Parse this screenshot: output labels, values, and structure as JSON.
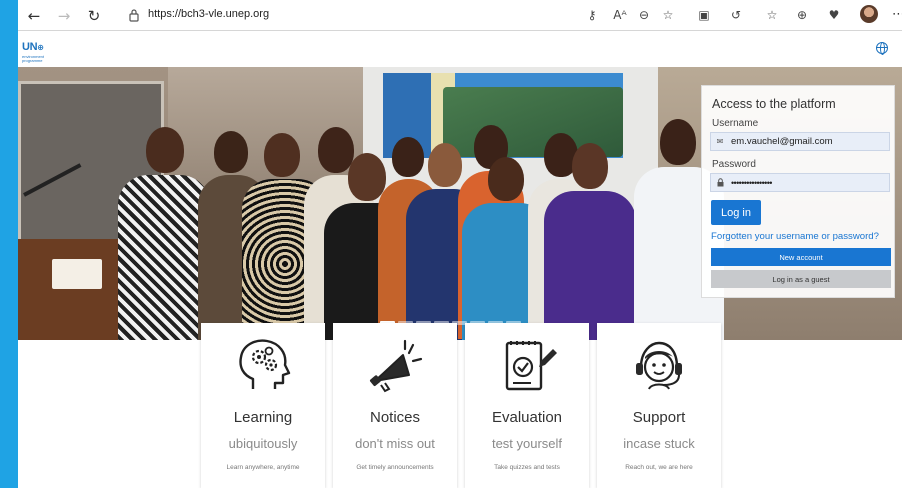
{
  "browser": {
    "url": "https://bch3-vle.unep.org",
    "back_glyph": "←",
    "forward_glyph": "→",
    "reload_glyph": "↻",
    "tools": [
      {
        "icon": "key-icon",
        "glyph": "⚷"
      },
      {
        "icon": "read-aloud-icon",
        "glyph": "Aᴬ"
      },
      {
        "icon": "zoom-icon",
        "glyph": "⊖"
      },
      {
        "icon": "favorite-add-icon",
        "glyph": "☆"
      },
      {
        "icon": "extension-icon",
        "glyph": "▣"
      },
      {
        "icon": "refresh-icon",
        "glyph": "↺"
      },
      {
        "icon": "favorites-icon",
        "glyph": "☆"
      },
      {
        "icon": "collections-icon",
        "glyph": "⊕"
      },
      {
        "icon": "heart-icon",
        "glyph": "♥"
      }
    ],
    "more_glyph": "⋯"
  },
  "header": {
    "logo_text": "UN",
    "logo_mark": "⊕",
    "logo_subtext": "environment programme"
  },
  "carousel": {
    "slide_count": 8,
    "active_index": 0
  },
  "login": {
    "title": "Access to the platform",
    "username_label": "Username",
    "username_value": "em.vauchel@gmail.com",
    "password_label": "Password",
    "password_value": "••••••••••••••••",
    "user_glyph": "✉",
    "lock_glyph": "🔒",
    "login_button": "Log in",
    "forgot_link": "Forgotten your username or password?",
    "new_account_button": "New account",
    "guest_button": "Log in as a guest"
  },
  "features": [
    {
      "icon": "head-gears-icon",
      "title": "Learning",
      "subtitle": "ubiquitously",
      "description": "Learn anywhere, anytime"
    },
    {
      "icon": "megaphone-icon",
      "title": "Notices",
      "subtitle": "don't miss out",
      "description": "Get timely announcements"
    },
    {
      "icon": "clipboard-check-icon",
      "title": "Evaluation",
      "subtitle": "test yourself",
      "description": "Take quizzes and tests"
    },
    {
      "icon": "headset-support-icon",
      "title": "Support",
      "subtitle": "incase stuck",
      "description": "Reach out, we are here"
    }
  ],
  "colors": {
    "accent": "#1976d2",
    "frame": "#1fa3e4",
    "guest_button": "#c7c9cc"
  }
}
